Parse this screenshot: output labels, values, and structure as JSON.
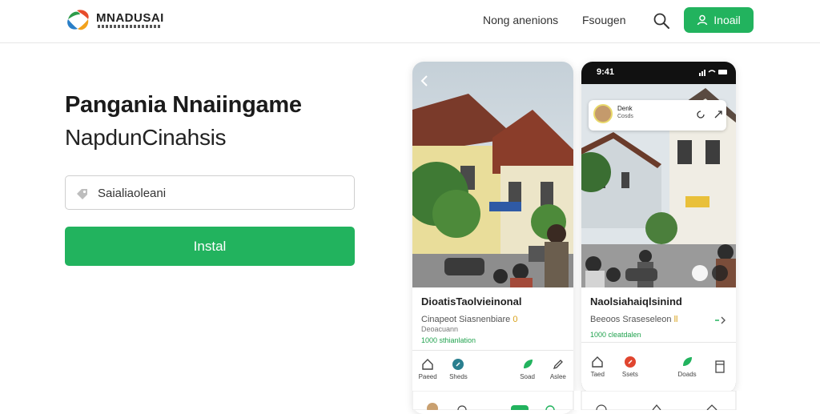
{
  "header": {
    "brand": "MNADUSAI",
    "nav": [
      "Nong anenions",
      "Fsougen"
    ],
    "install_label": "Inoail"
  },
  "hero": {
    "title": "Pangania Nnaiingame",
    "subtitle": "NapdunCinahsis",
    "search_value": "Saialiaoleani",
    "install_button": "Instal"
  },
  "cards": [
    {
      "title": "DioatisTaolvieinonal",
      "line1": "Cinapeot Siasnenbiare",
      "line1_value": "0",
      "line2": "Deoacuann",
      "price": "1000 sthianlation",
      "tabs": [
        "Paeed",
        "Sheds",
        "Soad",
        "Aslee"
      ]
    },
    {
      "status_time": "9:41",
      "profile_name": "Denk",
      "profile_sub": "Cosds",
      "title": "Naolsiahaiqlsinind",
      "line1": "Beeoos Sraseseleon",
      "line1_value": "ll",
      "price": "1000 cleatdalen",
      "tabs": [
        "Taed",
        "Ssets",
        "Doads"
      ]
    }
  ],
  "colors": {
    "accent": "#22b35e"
  }
}
